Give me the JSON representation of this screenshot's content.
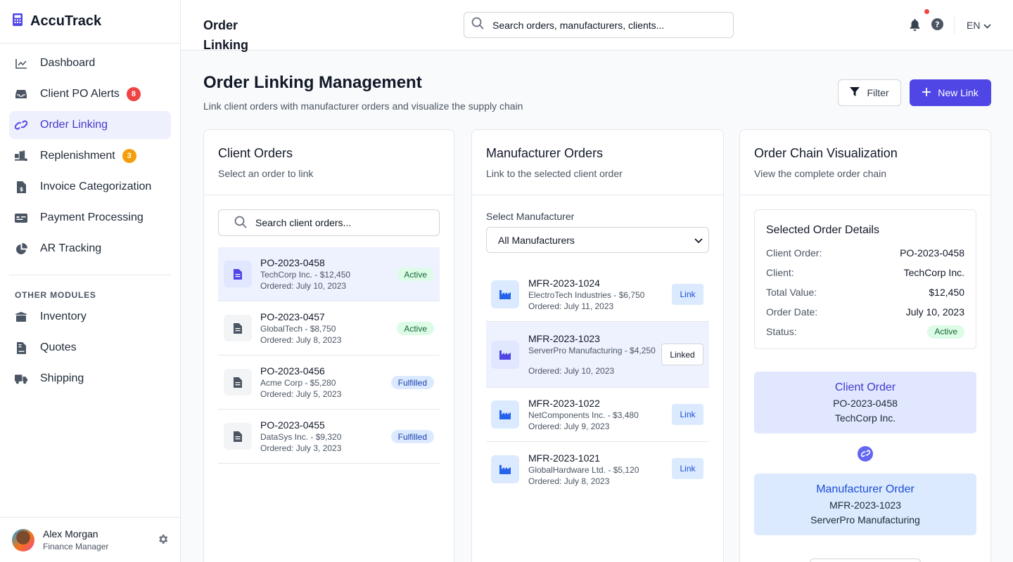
{
  "app": {
    "name": "AccuTrack"
  },
  "sidebar": {
    "items": [
      {
        "label": "Dashboard",
        "icon": "chart-line-icon"
      },
      {
        "label": "Client PO Alerts",
        "icon": "inbox-icon",
        "badge": "8"
      },
      {
        "label": "Order Linking",
        "icon": "link-icon",
        "active": true
      },
      {
        "label": "Replenishment",
        "icon": "truck-loading-icon",
        "badge": "3"
      },
      {
        "label": "Invoice Categorization",
        "icon": "file-invoice-dollar-icon"
      },
      {
        "label": "Payment Processing",
        "icon": "money-check-icon"
      },
      {
        "label": "AR Tracking",
        "icon": "chart-pie-icon"
      }
    ],
    "section_label": "OTHER MODULES",
    "other_items": [
      {
        "label": "Inventory",
        "icon": "warehouse-icon"
      },
      {
        "label": "Quotes",
        "icon": "file-contract-icon"
      },
      {
        "label": "Shipping",
        "icon": "shipping-truck-icon"
      }
    ],
    "user": {
      "name": "Alex Morgan",
      "role": "Finance Manager"
    }
  },
  "header": {
    "title": "Order Linking",
    "search_placeholder": "Search orders, manufacturers, clients...",
    "language": "EN"
  },
  "main": {
    "title": "Order Linking Management",
    "subtitle": "Link client orders with manufacturer orders and visualize the supply chain",
    "filter_label": "Filter",
    "new_link_label": "New Link"
  },
  "client_orders": {
    "title": "Client Orders",
    "subtitle": "Select an order to link",
    "search_placeholder": "Search client orders...",
    "orders": [
      {
        "id": "PO-2023-0458",
        "meta": "TechCorp Inc. - $12,450",
        "date": "Ordered: July 10, 2023",
        "status": "Active"
      },
      {
        "id": "PO-2023-0457",
        "meta": "GlobalTech - $8,750",
        "date": "Ordered: July 8, 2023",
        "status": "Active"
      },
      {
        "id": "PO-2023-0456",
        "meta": "Acme Corp - $5,280",
        "date": "Ordered: July 5, 2023",
        "status": "Fulfilled"
      },
      {
        "id": "PO-2023-0455",
        "meta": "DataSys Inc. - $9,320",
        "date": "Ordered: July 3, 2023",
        "status": "Fulfilled"
      }
    ]
  },
  "manufacturer_orders": {
    "title": "Manufacturer Orders",
    "subtitle": "Link to the selected client order",
    "select_label": "Select Manufacturer",
    "select_value": "All Manufacturers",
    "orders": [
      {
        "id": "MFR-2023-1024",
        "meta": "ElectroTech Industries - $6,750",
        "date": "Ordered: July 11, 2023",
        "action": "Link"
      },
      {
        "id": "MFR-2023-1023",
        "meta": "ServerPro Manufacturing - $4,250",
        "date": "Ordered: July 10, 2023",
        "action": "Linked"
      },
      {
        "id": "MFR-2023-1022",
        "meta": "NetComponents Inc. - $3,480",
        "date": "Ordered: July 9, 2023",
        "action": "Link"
      },
      {
        "id": "MFR-2023-1021",
        "meta": "GlobalHardware Ltd. - $5,120",
        "date": "Ordered: July 8, 2023",
        "action": "Link"
      }
    ]
  },
  "chain": {
    "title": "Order Chain Visualization",
    "subtitle": "View the complete order chain",
    "details_title": "Selected Order Details",
    "details": [
      {
        "label": "Client Order:",
        "value": "PO-2023-0458"
      },
      {
        "label": "Client:",
        "value": "TechCorp Inc."
      },
      {
        "label": "Total Value:",
        "value": "$12,450"
      },
      {
        "label": "Order Date:",
        "value": "July 10, 2023"
      },
      {
        "label": "Status:",
        "value": "Active"
      }
    ],
    "client_box": {
      "title": "Client Order",
      "id": "PO-2023-0458",
      "name": "TechCorp Inc."
    },
    "mfr_box": {
      "title": "Manufacturer Order",
      "id": "MFR-2023-1023",
      "name": "ServerPro Manufacturing"
    }
  }
}
